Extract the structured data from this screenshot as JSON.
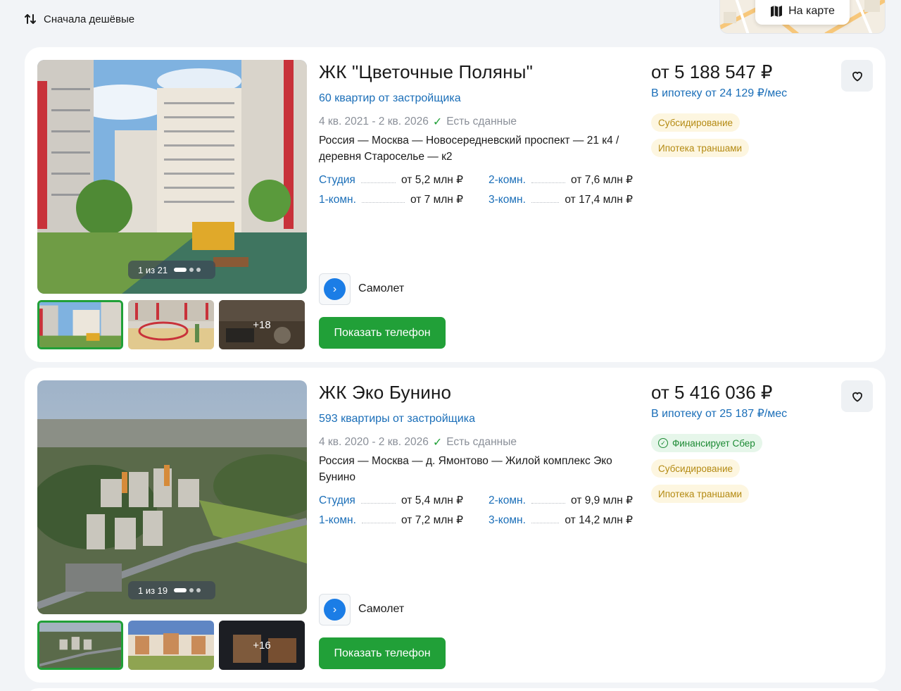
{
  "toolbar": {
    "sort_label": "Сначала дешёвые",
    "sort_icon": "sort-arrows-icon",
    "map_label": "На карте",
    "map_icon": "map-icon"
  },
  "listings": [
    {
      "title": "ЖК \"Цветочные Поляны\"",
      "flats_link": "60 квартир от застройщика",
      "dates": "4 кв. 2021 - 2 кв. 2026",
      "built_status": "Есть сданные",
      "address": "Россия — Москва — Новосередневский проспект — 21 к4 / деревня Староселье — к2",
      "photo_counter": "1 из 21",
      "thumbs_more": "+18",
      "room_prices": [
        {
          "type": "Студия",
          "price": "от 5,2 млн ₽"
        },
        {
          "type": "2-комн.",
          "price": "от 7,6 млн ₽"
        },
        {
          "type": "1-комн.",
          "price": "от 7 млн ₽"
        },
        {
          "type": "3-комн.",
          "price": "от 17,4 млн ₽"
        }
      ],
      "developer": "Самолет",
      "phone_button": "Показать телефон",
      "price": "от 5 188 547 ₽",
      "mortgage": "В ипотеку от 24 129 ₽/мес",
      "badges": [
        "Субсидирование",
        "Ипотека траншами"
      ]
    },
    {
      "title": "ЖК Эко Бунино",
      "flats_link": "593 квартиры от застройщика",
      "dates": "4 кв. 2020 - 2 кв. 2026",
      "built_status": "Есть сданные",
      "address": "Россия — Москва — д. Ямонтово — Жилой комплекс Эко Бунино",
      "photo_counter": "1 из 19",
      "thumbs_more": "+16",
      "room_prices": [
        {
          "type": "Студия",
          "price": "от 5,4 млн ₽"
        },
        {
          "type": "2-комн.",
          "price": "от 9,9 млн ₽"
        },
        {
          "type": "1-комн.",
          "price": "от 7,2 млн ₽"
        },
        {
          "type": "3-комн.",
          "price": "от 14,2 млн ₽"
        }
      ],
      "developer": "Самолет",
      "phone_button": "Показать телефон",
      "price": "от 5 416 036 ₽",
      "mortgage": "В ипотеку от 25 187 ₽/мес",
      "green_badge": "Финансирует Сбер",
      "badges": [
        "Субсидирование",
        "Ипотека траншами"
      ]
    }
  ],
  "colors": {
    "accent_green": "#21a038",
    "link_blue": "#1a6eb8",
    "badge_yellow_text": "#b48a12"
  }
}
